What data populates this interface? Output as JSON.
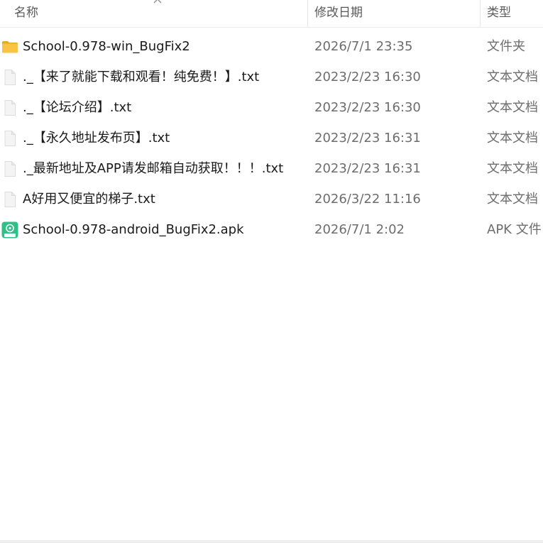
{
  "columns": {
    "name": "名称",
    "date": "修改日期",
    "type": "类型"
  },
  "files": [
    {
      "icon": "folder-icon",
      "name": "School-0.978-win_BugFix2",
      "date": "2026/7/1 23:35",
      "type": "文件夹"
    },
    {
      "icon": "text-file-icon",
      "name": "._【来了就能下载和观看！纯免费！】.txt",
      "date": "2023/2/23 16:30",
      "type": "文本文档"
    },
    {
      "icon": "text-file-icon",
      "name": "._【论坛介绍】.txt",
      "date": "2023/2/23 16:30",
      "type": "文本文档"
    },
    {
      "icon": "text-file-icon",
      "name": "._【永久地址发布页】.txt",
      "date": "2023/2/23 16:31",
      "type": "文本文档"
    },
    {
      "icon": "text-file-icon",
      "name": "._最新地址及APP请发邮箱自动获取！！！.txt",
      "date": "2023/2/23 16:31",
      "type": "文本文档"
    },
    {
      "icon": "text-file-icon",
      "name": "A好用又便宜的梯子.txt",
      "date": "2026/3/22 11:16",
      "type": "文本文档"
    },
    {
      "icon": "apk-file-icon",
      "name": "School-0.978-android_BugFix2.apk",
      "date": "2026/7/1 2:02",
      "type": "APK 文件"
    }
  ],
  "colors": {
    "folder": "#f7c444",
    "apk": "#2fbf87",
    "header_text": "#5a5a5a",
    "meta_text": "#6d6d6d"
  }
}
